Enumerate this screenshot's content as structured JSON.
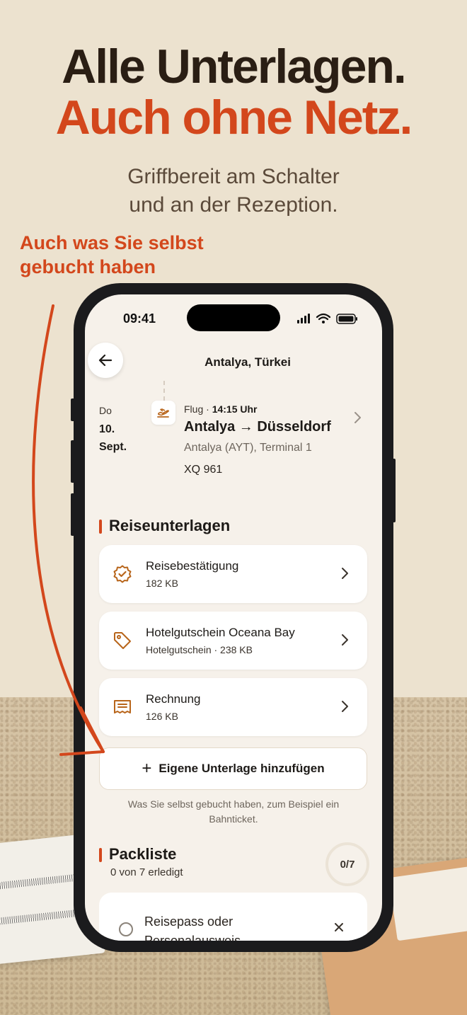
{
  "headline": {
    "line1": "Alle Unterlagen.",
    "line2": "Auch ohne Netz.",
    "sub_line1": "Griffbereit am Schalter",
    "sub_line2": "und an der Rezeption.",
    "callout_line1": "Auch was Sie selbst",
    "callout_line2": "gebucht haben"
  },
  "colors": {
    "accent": "#d3471c",
    "icon_brown": "#b8651b",
    "background": "#ece2cf"
  },
  "status_bar": {
    "time": "09:41"
  },
  "nav": {
    "title": "Antalya, Türkei",
    "back_icon": "arrow-left-icon"
  },
  "flight": {
    "day": "Do",
    "date_line1": "10.",
    "date_line2": "Sept.",
    "type": "Flug · ",
    "time": "14:15 Uhr",
    "route": "Antalya → Düsseldorf",
    "airport": "Antalya (AYT), Terminal 1",
    "flight_number": "XQ 961",
    "icon": "plane-takeoff-icon"
  },
  "documents": {
    "title": "Reiseunterlagen",
    "items": [
      {
        "title": "Reisebestätigung",
        "sub": "182 KB",
        "icon": "badge-check-icon"
      },
      {
        "title": "Hotelgutschein Oceana Bay",
        "sub": "Hotelgutschein · 238 KB",
        "icon": "tag-icon"
      },
      {
        "title": "Rechnung",
        "sub": "126 KB",
        "icon": "receipt-icon"
      }
    ],
    "add_label": "Eigene Unterlage hinzufügen",
    "hint": "Was Sie selbst gebucht haben, zum Beispiel ein Bahnticket."
  },
  "packlist": {
    "title": "Packliste",
    "progress_text": "0 von 7 erledigt",
    "done": 0,
    "total": 7,
    "ring_label": "0/7",
    "items": [
      {
        "label": "Reisepass oder Personalausweis",
        "checked": false
      }
    ]
  }
}
